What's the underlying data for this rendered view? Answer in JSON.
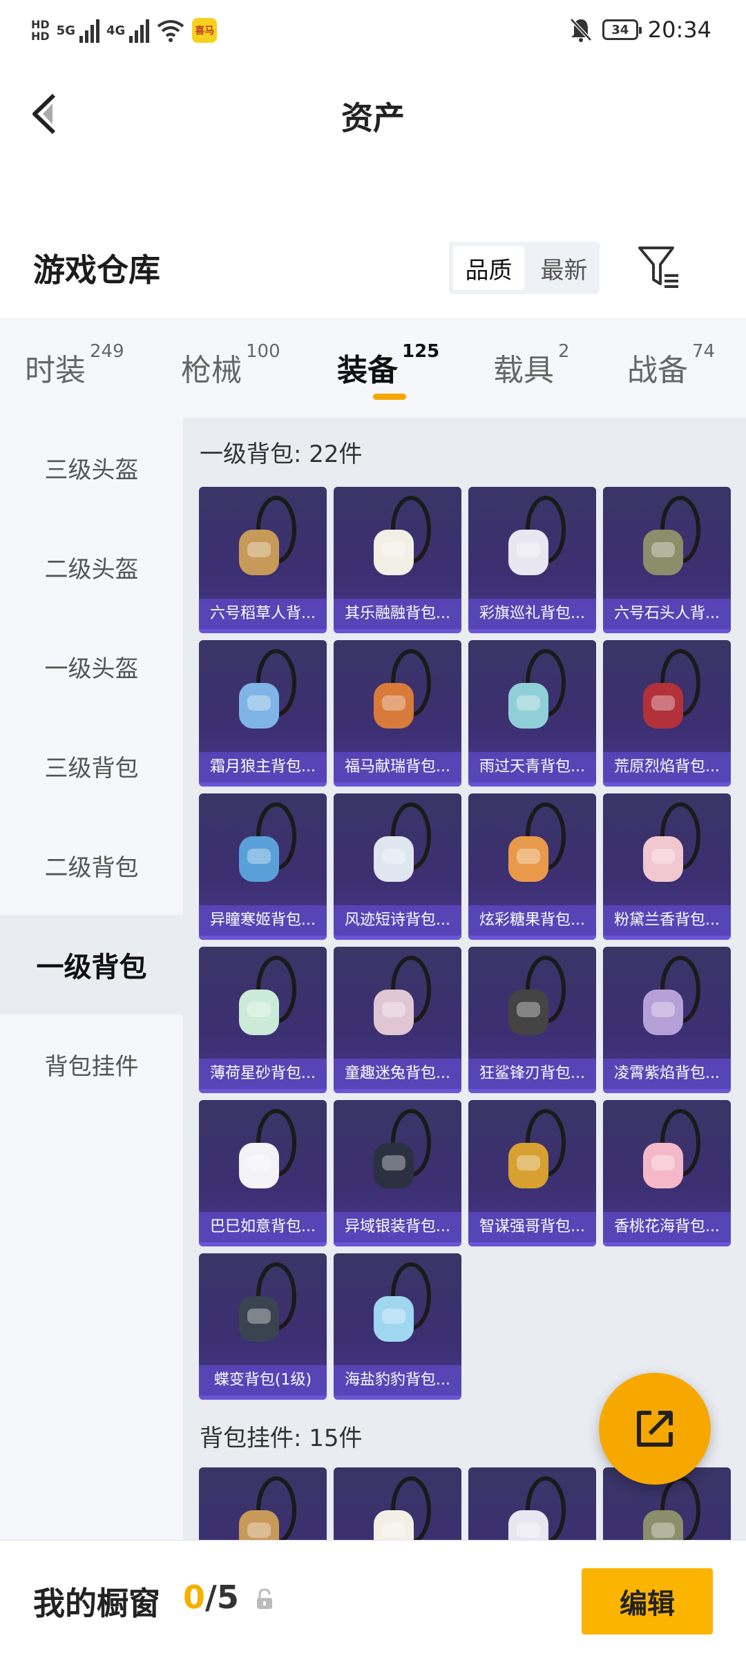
{
  "status_bar": {
    "hd_top": "HD",
    "hd_bottom": "HD",
    "network_1": "5G",
    "network_2": "4G",
    "app_badge": "喜马",
    "battery": "34",
    "time": "20:34"
  },
  "header": {
    "title": "资产"
  },
  "section": {
    "title": "游戏仓库",
    "sort_options": [
      "品质",
      "最新"
    ],
    "sort_selected": "品质"
  },
  "tabs": [
    {
      "label": "时装",
      "count": "249"
    },
    {
      "label": "枪械",
      "count": "100"
    },
    {
      "label": "装备",
      "count": "125",
      "active": true
    },
    {
      "label": "载具",
      "count": "2"
    },
    {
      "label": "战备",
      "count": "74"
    }
  ],
  "sidebar": {
    "items": [
      "三级头盔",
      "二级头盔",
      "一级头盔",
      "三级背包",
      "二级背包",
      "一级背包",
      "背包挂件"
    ],
    "active": "一级背包"
  },
  "groups": [
    {
      "title": "一级背包: 22件",
      "items": [
        "六号稻草人背...",
        "其乐融融背包...",
        "彩旗巡礼背包...",
        "六号石头人背...",
        "霜月狼主背包...",
        "福马献瑞背包...",
        "雨过天青背包...",
        "荒原烈焰背包...",
        "异瞳寒姬背包...",
        "风迹短诗背包...",
        "炫彩糖果背包...",
        "粉黛兰香背包...",
        "薄荷星砂背包...",
        "童趣迷兔背包...",
        "狂鲨锋刃背包...",
        "凌霄紫焰背包...",
        "巴巳如意背包...",
        "异域银装背包...",
        "智谋强哥背包...",
        "香桃花海背包...",
        "蝶变背包(1级)",
        "海盐豹豹背包..."
      ]
    },
    {
      "title": "背包挂件: 15件",
      "items": [
        "",
        "",
        "",
        ""
      ]
    }
  ],
  "bottom": {
    "showcase_label": "我的橱窗",
    "count_current": "0",
    "count_sep": "/",
    "count_total": "5",
    "edit_label": "编辑"
  },
  "colors": {
    "accent": "#f5a800",
    "card_bg": "#3c2f72",
    "card_label": "#5a46be"
  },
  "icons": [
    "back-arrow-icon",
    "filter-icon",
    "share-out-icon",
    "lock-icon",
    "bell-muted-icon",
    "wifi-icon",
    "signal-icon"
  ]
}
